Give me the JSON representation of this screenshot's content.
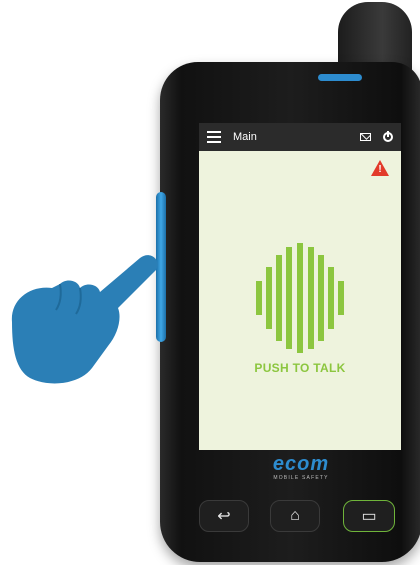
{
  "app": {
    "title": "Main"
  },
  "statusbar": {
    "menu_icon": "hamburger-icon",
    "mail_icon": "mail-icon",
    "power_icon": "power-icon"
  },
  "alert": {
    "icon": "warning-icon",
    "color": "#e23a2a"
  },
  "ptt": {
    "label": "PUSH TO TALK",
    "color": "#8cc63f"
  },
  "brand": {
    "name": "ecom",
    "tagline": "MOBILE SAFETY"
  },
  "navkeys": {
    "back_glyph": "↩",
    "home_glyph": "⌂",
    "recent_glyph": "▭"
  },
  "colors": {
    "screen_bg": "#eef3dd",
    "accent_blue": "#2d8ccf",
    "statusbar": "#2b2b2b"
  }
}
